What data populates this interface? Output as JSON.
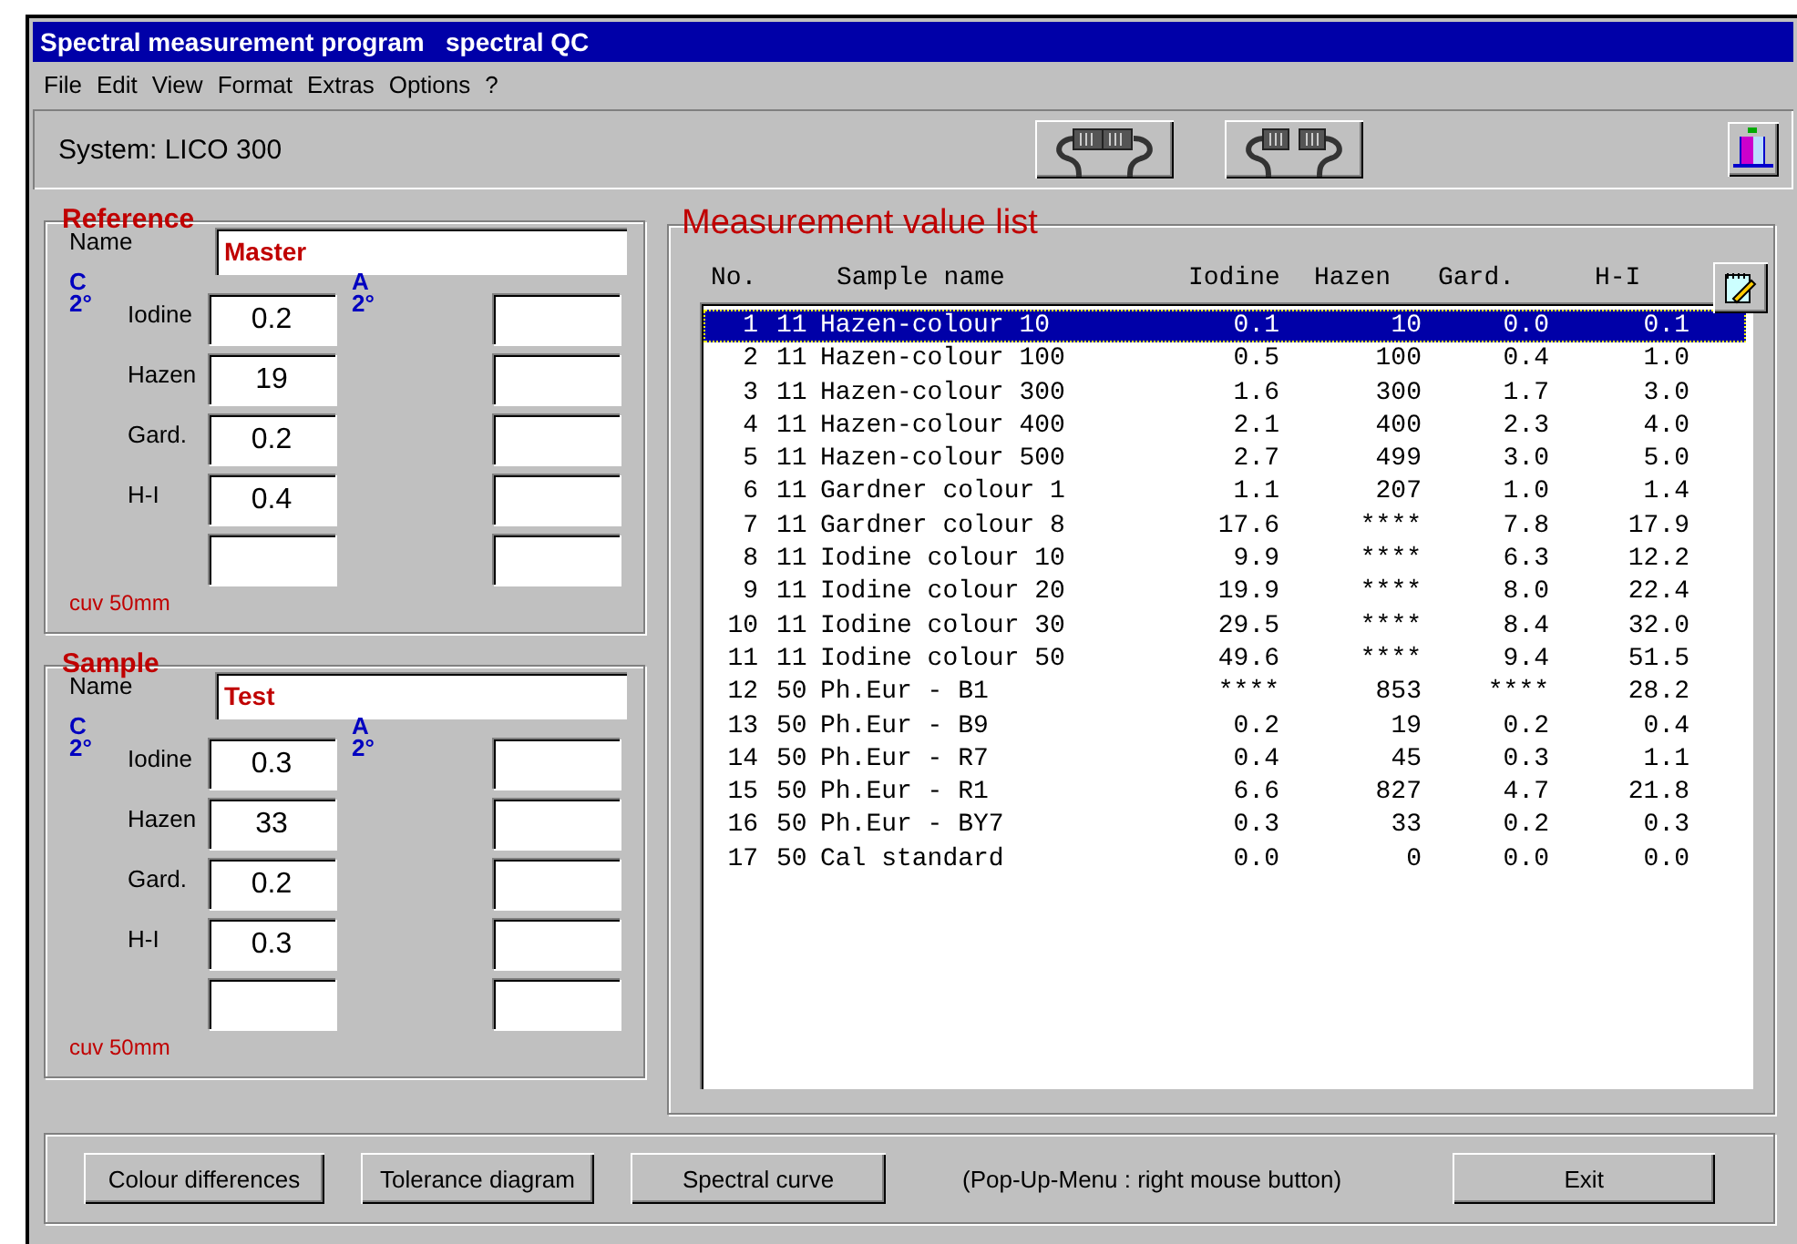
{
  "window": {
    "title": "Spectral measurement program   spectral QC"
  },
  "menu": [
    "File",
    "Edit",
    "View",
    "Format",
    "Extras",
    "Options",
    "?"
  ],
  "toolbar": {
    "system": "System: LICO 300"
  },
  "groups": [
    {
      "title": "Reference",
      "name_label": "Name",
      "name": "Master",
      "c_label": "C",
      "c_angle": "2°",
      "a_label": "A",
      "a_angle": "2°",
      "fields": [
        {
          "label": "Iodine",
          "value": "0.2"
        },
        {
          "label": "Hazen",
          "value": "19"
        },
        {
          "label": "Gard.",
          "value": "0.2"
        },
        {
          "label": "H-I",
          "value": "0.4"
        }
      ],
      "cuvette": "cuv 50mm"
    },
    {
      "title": "Sample",
      "name_label": "Name",
      "name": "Test",
      "c_label": "C",
      "c_angle": "2°",
      "a_label": "A",
      "a_angle": "2°",
      "fields": [
        {
          "label": "Iodine",
          "value": "0.3"
        },
        {
          "label": "Hazen",
          "value": "33"
        },
        {
          "label": "Gard.",
          "value": "0.2"
        },
        {
          "label": "H-I",
          "value": "0.3"
        }
      ],
      "cuvette": "cuv 50mm"
    }
  ],
  "measurement_list": {
    "title": "Measurement value list",
    "columns": [
      "No.",
      "Sample name",
      "Iodine",
      "Hazen",
      "Gard.",
      "H-I"
    ],
    "rows": [
      {
        "no": "1",
        "group": "11",
        "name": "Hazen-colour 10",
        "iodine": "0.1",
        "hazen": "10",
        "gard": "0.0",
        "hi": "0.1",
        "selected": true
      },
      {
        "no": "2",
        "group": "11",
        "name": "Hazen-colour 100",
        "iodine": "0.5",
        "hazen": "100",
        "gard": "0.4",
        "hi": "1.0",
        "selected": false
      },
      {
        "no": "3",
        "group": "11",
        "name": "Hazen-colour 300",
        "iodine": "1.6",
        "hazen": "300",
        "gard": "1.7",
        "hi": "3.0",
        "selected": false
      },
      {
        "no": "4",
        "group": "11",
        "name": "Hazen-colour 400",
        "iodine": "2.1",
        "hazen": "400",
        "gard": "2.3",
        "hi": "4.0",
        "selected": false
      },
      {
        "no": "5",
        "group": "11",
        "name": "Hazen-colour 500",
        "iodine": "2.7",
        "hazen": "499",
        "gard": "3.0",
        "hi": "5.0",
        "selected": false
      },
      {
        "no": "6",
        "group": "11",
        "name": "Gardner colour 1",
        "iodine": "1.1",
        "hazen": "207",
        "gard": "1.0",
        "hi": "1.4",
        "selected": false
      },
      {
        "no": "7",
        "group": "11",
        "name": "Gardner colour 8",
        "iodine": "17.6",
        "hazen": "****",
        "gard": "7.8",
        "hi": "17.9",
        "selected": false
      },
      {
        "no": "8",
        "group": "11",
        "name": "Iodine colour 10",
        "iodine": "9.9",
        "hazen": "****",
        "gard": "6.3",
        "hi": "12.2",
        "selected": false
      },
      {
        "no": "9",
        "group": "11",
        "name": "Iodine colour 20",
        "iodine": "19.9",
        "hazen": "****",
        "gard": "8.0",
        "hi": "22.4",
        "selected": false
      },
      {
        "no": "10",
        "group": "11",
        "name": "Iodine colour 30",
        "iodine": "29.5",
        "hazen": "****",
        "gard": "8.4",
        "hi": "32.0",
        "selected": false
      },
      {
        "no": "11",
        "group": "11",
        "name": "Iodine colour 50",
        "iodine": "49.6",
        "hazen": "****",
        "gard": "9.4",
        "hi": "51.5",
        "selected": false
      },
      {
        "no": "12",
        "group": "50",
        "name": "Ph.Eur - B1",
        "iodine": "****",
        "hazen": "853",
        "gard": "****",
        "hi": "28.2",
        "selected": false
      },
      {
        "no": "13",
        "group": "50",
        "name": "Ph.Eur - B9",
        "iodine": "0.2",
        "hazen": "19",
        "gard": "0.2",
        "hi": "0.4",
        "selected": false
      },
      {
        "no": "14",
        "group": "50",
        "name": "Ph.Eur - R7",
        "iodine": "0.4",
        "hazen": "45",
        "gard": "0.3",
        "hi": "1.1",
        "selected": false
      },
      {
        "no": "15",
        "group": "50",
        "name": "Ph.Eur - R1",
        "iodine": "6.6",
        "hazen": "827",
        "gard": "4.7",
        "hi": "21.8",
        "selected": false
      },
      {
        "no": "16",
        "group": "50",
        "name": "Ph.Eur - BY7",
        "iodine": "0.3",
        "hazen": "33",
        "gard": "0.2",
        "hi": "0.3",
        "selected": false
      },
      {
        "no": "17",
        "group": "50",
        "name": "Cal standard",
        "iodine": "0.0",
        "hazen": "0",
        "gard": "0.0",
        "hi": "0.0",
        "selected": false
      }
    ]
  },
  "bottom_bar": [
    {
      "kind": "button",
      "label": "Colour differences"
    },
    {
      "kind": "button",
      "label": "Tolerance diagram"
    },
    {
      "kind": "button",
      "label": "Spectral curve"
    },
    {
      "kind": "note",
      "label": "(Pop-Up-Menu : right mouse button)"
    },
    {
      "kind": "button",
      "label": "Exit"
    }
  ]
}
